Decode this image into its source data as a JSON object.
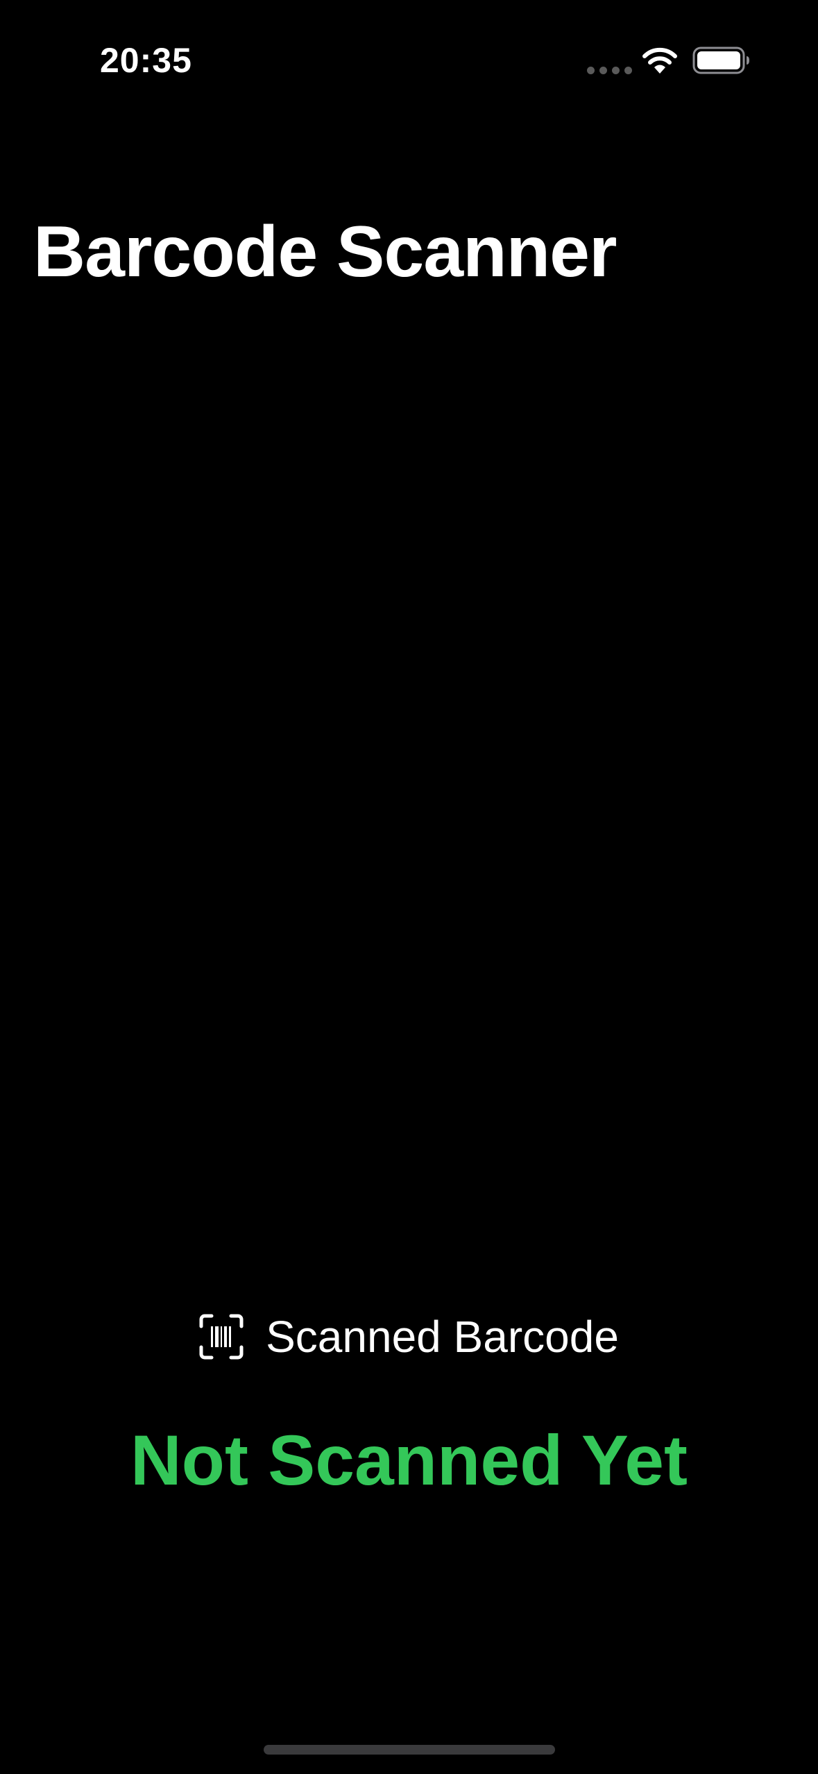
{
  "status_bar": {
    "time": "20:35",
    "icons": [
      "cellular-signal-icon",
      "wifi-icon",
      "battery-icon"
    ]
  },
  "header": {
    "title": "Barcode Scanner"
  },
  "scanner": {
    "label_icon": "barcode-viewfinder-icon",
    "label": "Scanned Barcode",
    "result": "Not Scanned Yet"
  },
  "colors": {
    "background": "#000000",
    "text": "#ffffff",
    "result": "#34c759",
    "home_indicator": "#3a3a3c"
  }
}
